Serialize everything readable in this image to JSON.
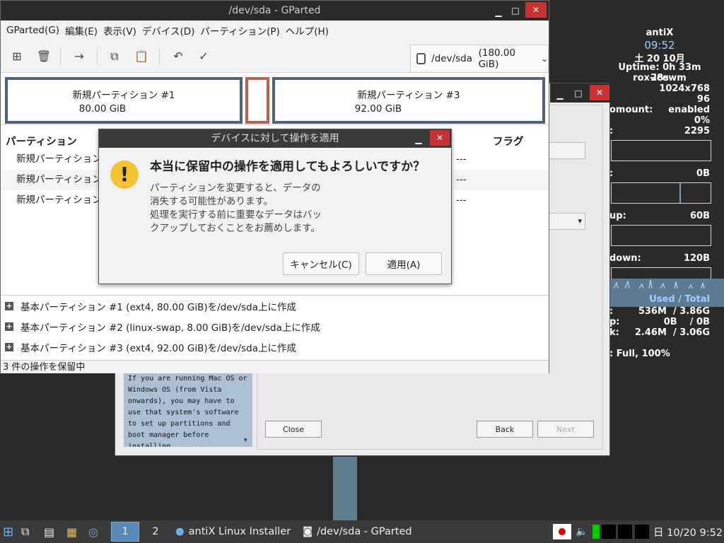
{
  "conky": {
    "hostname": "antiX",
    "time": "09:52",
    "date": "土 20 10月",
    "uptime": "Uptime: 0h 33m 28s",
    "wm": "rox-icewm",
    "resolution": "1024x768",
    "dpi": "96",
    "automount_label": "omount:",
    "automount_value": "enabled",
    "cpu_value": "0%",
    "freq_label": ":",
    "freq_value": "2295",
    "disk_label": ":",
    "disk_value": "0B",
    "up_label": "up:",
    "up_value": "60B",
    "down_label": "down:",
    "down_value": "120B",
    "used_total": "Used / Total",
    "ram_label": ":",
    "ram_used": "536M",
    "ram_total": "/ 3.86G",
    "swap_label": "p:",
    "swap_used": "0B",
    "swap_total": "/ 0B",
    "disk2_label": "k:",
    "disk2_used": "2.46M",
    "disk2_total": "/ 3.06G",
    "battery": ": Full, 100%"
  },
  "installer": {
    "info_text": "If you are running Mac OS or Windows OS (from Vista onwards), you may have to use that system's software to set up partitions and boot manager before installing",
    "close_label": "Close",
    "back_label": "Back",
    "next_label": "Next"
  },
  "gparted": {
    "window_title": "/dev/sda - GParted",
    "menu": [
      "GParted(G)",
      "編集(E)",
      "表示(V)",
      "デバイス(D)",
      "パーティション(P)",
      "ヘルプ(H)"
    ],
    "device": "/dev/sda",
    "device_size": "(180.00 GiB)",
    "partitions_map": [
      {
        "name": "新規パーティション #1",
        "size": "80.00 GiB"
      },
      {
        "name": "新規パーティション #3",
        "size": "92.00 GiB"
      }
    ],
    "col_partition": "パーティション",
    "col_flags": "フラグ",
    "rows": [
      {
        "name": "新規パーティション",
        "flags": "---"
      },
      {
        "name": "新規パーティション",
        "flags": "---"
      },
      {
        "name": "新規パーティション",
        "flags": "---"
      }
    ],
    "operations": [
      "基本パーティション #1 (ext4, 80.00 GiB)を/dev/sda上に作成",
      "基本パーティション #2 (linux-swap, 8.00 GiB)を/dev/sda上に作成",
      "基本パーティション #3 (ext4, 92.00 GiB)を/dev/sda上に作成"
    ],
    "status": "3 件の操作を保留中"
  },
  "dialog": {
    "title": "デバイスに対して操作を適用",
    "heading": "本当に保留中の操作を適用してもよろしいですか？",
    "body_lines": [
      "パーティションを変更すると、データの",
      "消失する可能性があります。",
      "処理を実行する前に重要なデータはバッ",
      "クアップしておくことをお薦めします。"
    ],
    "cancel_label": "キャンセル(C)",
    "apply_label": "適用(A)"
  },
  "taskbar": {
    "workspace": "2",
    "task1": "antiX Linux Installer",
    "task2": "/dev/sda - GParted",
    "clock": "日 10/20  9:52"
  }
}
